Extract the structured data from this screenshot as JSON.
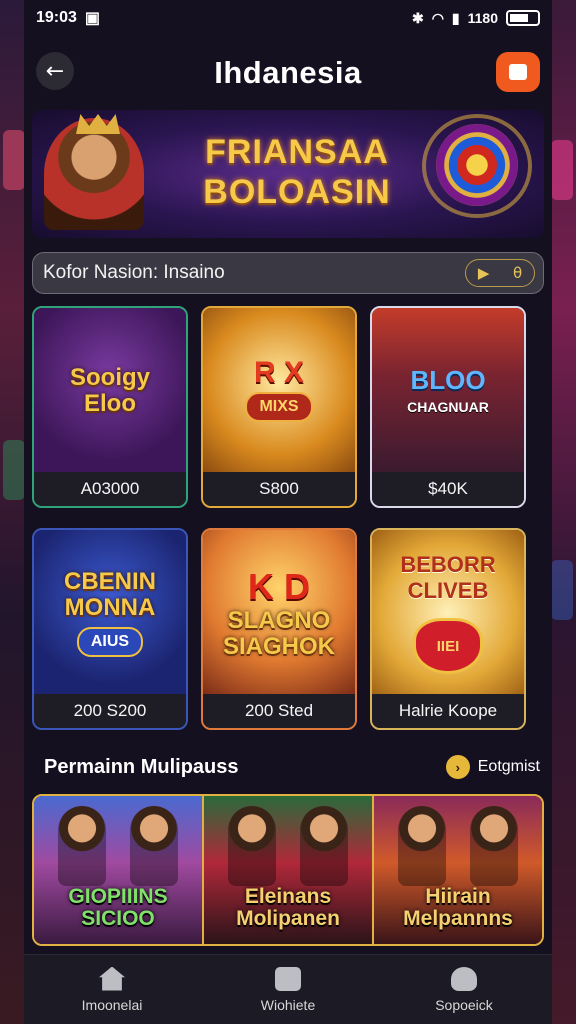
{
  "status_bar": {
    "time": "19:03",
    "left_icons": [
      "image-icon"
    ],
    "right_icons": [
      "bluetooth-icon",
      "wifi-icon",
      "signal-icon",
      "battery-icon"
    ],
    "battery_label": "1180"
  },
  "header": {
    "title": "Ihdanesia"
  },
  "banner": {
    "title_line1": "FRIANSAA",
    "title_line2": "BOLOASIN"
  },
  "search": {
    "label": "Kofor Nasion: Insaino",
    "action1": "▶",
    "action2": "θ"
  },
  "games": [
    {
      "name": "Sooigy",
      "sub": "Eloo",
      "price": "A03000"
    },
    {
      "name": "R X",
      "sub": "MIXS",
      "price": "S800"
    },
    {
      "name": "BLOO",
      "sub": "CHAGNUAR",
      "price": "$40K"
    },
    {
      "name": "CBENIN MONNA",
      "sub": "AIUS",
      "price": "200 S200"
    },
    {
      "name": "K D",
      "sub": "SLAGNO SIAGHOK",
      "price": "200 Sted"
    },
    {
      "name": "BEBORR CLIVEB",
      "sub": "IIEI",
      "price": "Halrie Koope"
    }
  ],
  "section": {
    "title": "Permainn Mulipauss",
    "more_label": "Eotgmist"
  },
  "multiplayer": [
    {
      "title": "GIOPIIINS SICIOO"
    },
    {
      "title": "Eleinans Molipanen"
    },
    {
      "title": "Hiirain Melpannns"
    }
  ],
  "bottom_nav": [
    {
      "label": "Imoonelai",
      "icon": "home-icon"
    },
    {
      "label": "Wiohiete",
      "icon": "favorites-icon"
    },
    {
      "label": "Sopoeick",
      "icon": "support-icon"
    }
  ],
  "colors": {
    "background": "#141020",
    "accent": "#f05a1e",
    "gold": "#e0b040"
  }
}
